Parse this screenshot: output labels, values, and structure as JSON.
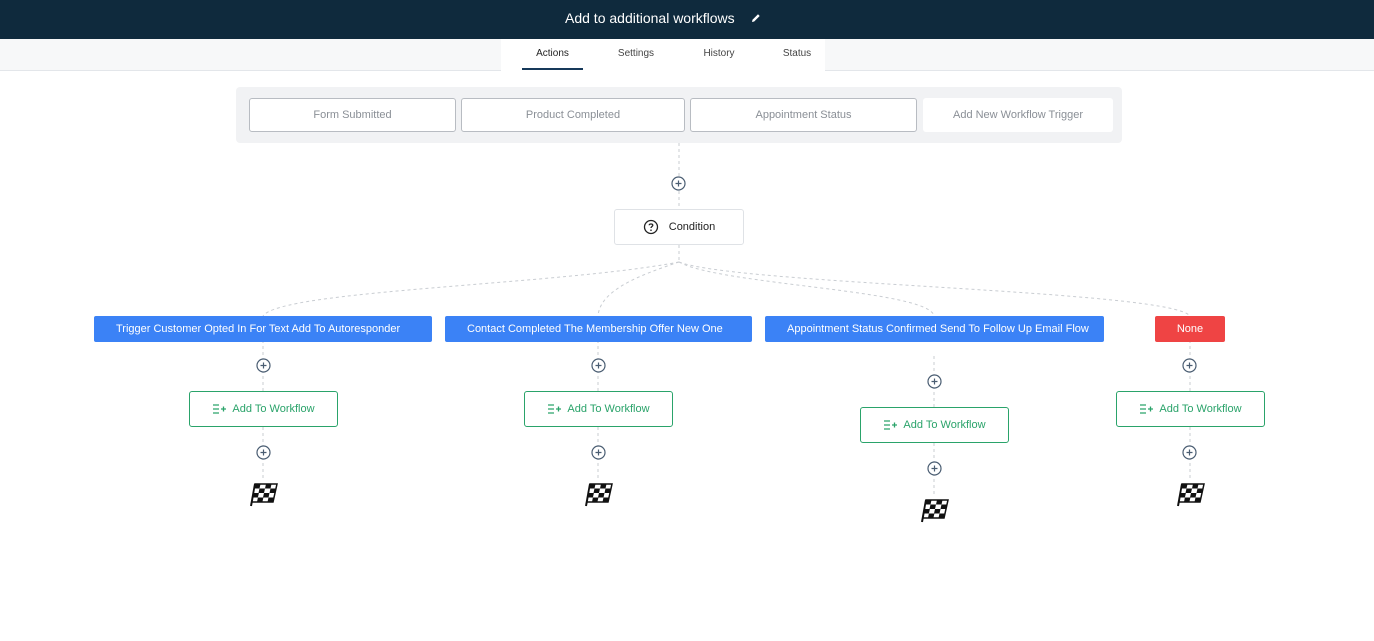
{
  "header": {
    "title": "Add to additional workflows",
    "edit_icon": "pencil-icon"
  },
  "tabs": [
    {
      "label": "Actions",
      "active": true
    },
    {
      "label": "Settings",
      "active": false
    },
    {
      "label": "History",
      "active": false
    },
    {
      "label": "Status",
      "active": false
    }
  ],
  "triggers": [
    {
      "label": "Form Submitted"
    },
    {
      "label": "Product Completed"
    },
    {
      "label": "Appointment Status"
    },
    {
      "label": "Add New Workflow Trigger"
    }
  ],
  "condition": {
    "label": "Condition",
    "icon": "question-circle-icon"
  },
  "branches": [
    {
      "label": "Trigger Customer Opted In For Text Add To Autoresponder",
      "color": "#3b82f6"
    },
    {
      "label": "Contact Completed The Membership Offer New One",
      "color": "#3b82f6"
    },
    {
      "label": "Appointment Status Confirmed Send To Follow Up Email Flow",
      "color": "#3b82f6"
    },
    {
      "label": "None",
      "color": "#ef4444"
    }
  ],
  "actions": [
    {
      "label": "Add To Workflow",
      "icon": "list-add-icon"
    },
    {
      "label": "Add To Workflow",
      "icon": "list-add-icon"
    },
    {
      "label": "Add To Workflow",
      "icon": "list-add-icon"
    },
    {
      "label": "Add To Workflow",
      "icon": "list-add-icon"
    }
  ],
  "colors": {
    "header_bg": "#0f2a3d",
    "branch_blue": "#3b82f6",
    "branch_red": "#ef4444",
    "action_green": "#2aa36a"
  }
}
